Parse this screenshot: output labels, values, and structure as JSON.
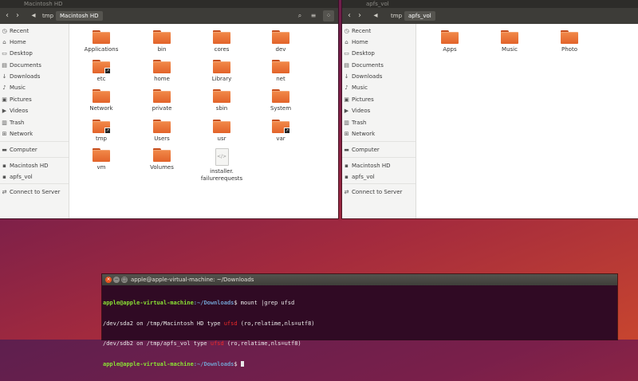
{
  "left_window": {
    "title": "Macintosh HD",
    "crumbs": [
      "tmp",
      "Macintosh HD"
    ],
    "sidebar": [
      {
        "label": "Recent",
        "icon": "clock-icon"
      },
      {
        "label": "Home",
        "icon": "home-icon"
      },
      {
        "label": "Desktop",
        "icon": "desktop-icon"
      },
      {
        "label": "Documents",
        "icon": "documents-icon"
      },
      {
        "label": "Downloads",
        "icon": "downloads-icon"
      },
      {
        "label": "Music",
        "icon": "music-icon"
      },
      {
        "label": "Pictures",
        "icon": "pictures-icon"
      },
      {
        "label": "Videos",
        "icon": "videos-icon"
      },
      {
        "label": "Trash",
        "icon": "trash-icon"
      },
      {
        "label": "Network",
        "icon": "network-icon"
      },
      {
        "label": "Computer",
        "icon": "computer-icon"
      },
      {
        "label": "Macintosh HD",
        "icon": "drive-icon"
      },
      {
        "label": "apfs_vol",
        "icon": "drive-icon"
      },
      {
        "label": "Connect to Server",
        "icon": "server-icon"
      }
    ],
    "items": [
      {
        "label": "Applications",
        "type": "folder"
      },
      {
        "label": "bin",
        "type": "folder"
      },
      {
        "label": "cores",
        "type": "folder"
      },
      {
        "label": "dev",
        "type": "folder"
      },
      {
        "label": "etc",
        "type": "folder-link"
      },
      {
        "label": "home",
        "type": "folder"
      },
      {
        "label": "Library",
        "type": "folder"
      },
      {
        "label": "net",
        "type": "folder"
      },
      {
        "label": "Network",
        "type": "folder"
      },
      {
        "label": "private",
        "type": "folder"
      },
      {
        "label": "sbin",
        "type": "folder"
      },
      {
        "label": "System",
        "type": "folder"
      },
      {
        "label": "tmp",
        "type": "folder-link"
      },
      {
        "label": "Users",
        "type": "folder"
      },
      {
        "label": "usr",
        "type": "folder"
      },
      {
        "label": "var",
        "type": "folder-link"
      },
      {
        "label": "vm",
        "type": "folder"
      },
      {
        "label": "Volumes",
        "type": "folder"
      },
      {
        "label": "installer.\nfailurerequests",
        "type": "file"
      }
    ]
  },
  "right_window": {
    "title": "apfs_vol",
    "crumbs": [
      "tmp",
      "apfs_vol"
    ],
    "sidebar": [
      {
        "label": "Recent",
        "icon": "clock-icon"
      },
      {
        "label": "Home",
        "icon": "home-icon"
      },
      {
        "label": "Desktop",
        "icon": "desktop-icon"
      },
      {
        "label": "Documents",
        "icon": "documents-icon"
      },
      {
        "label": "Downloads",
        "icon": "downloads-icon"
      },
      {
        "label": "Music",
        "icon": "music-icon"
      },
      {
        "label": "Pictures",
        "icon": "pictures-icon"
      },
      {
        "label": "Videos",
        "icon": "videos-icon"
      },
      {
        "label": "Trash",
        "icon": "trash-icon"
      },
      {
        "label": "Network",
        "icon": "network-icon"
      },
      {
        "label": "Computer",
        "icon": "computer-icon"
      },
      {
        "label": "Macintosh HD",
        "icon": "drive-icon"
      },
      {
        "label": "apfs_vol",
        "icon": "drive-icon"
      },
      {
        "label": "Connect to Server",
        "icon": "server-icon"
      }
    ],
    "items": [
      {
        "label": "Apps",
        "type": "folder"
      },
      {
        "label": "Music",
        "type": "folder"
      },
      {
        "label": "Photo",
        "type": "folder"
      }
    ]
  },
  "terminal": {
    "title": "apple@apple-virtual-machine: ~/Downloads",
    "lines": [
      {
        "prompt": "apple@apple-virtual-machine",
        "path": ":~/Downloads",
        "cmd": "$ mount |grep ufsd"
      },
      {
        "pre": "/dev/sda2 on /tmp/Macintosh HD type ",
        "hl": "ufsd",
        "post": " (ro,relatime,nls=utf8)"
      },
      {
        "pre": "/dev/sdb2 on /tmp/apfs_vol type ",
        "hl": "ufsd",
        "post": " (ro,relatime,nls=utf8)"
      },
      {
        "prompt": "apple@apple-virtual-machine",
        "path": ":~/Downloads",
        "cmd": "$ "
      }
    ]
  }
}
